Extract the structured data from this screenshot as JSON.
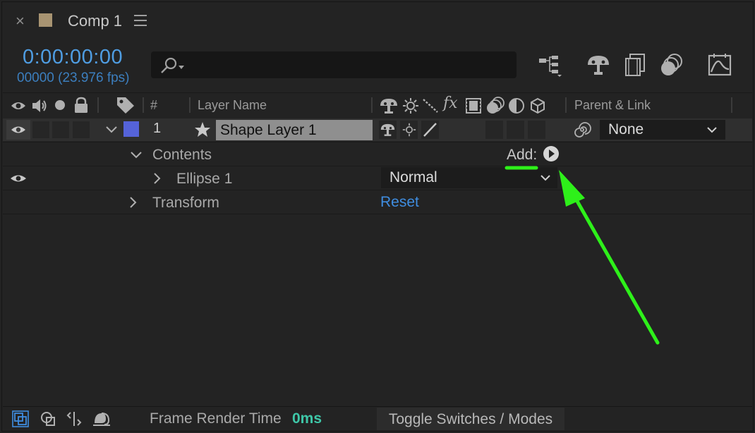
{
  "tab": {
    "close": "×",
    "title": "Comp 1"
  },
  "timecode": {
    "time": "0:00:00:00",
    "frames": "00000 (23.976 fps)"
  },
  "search": {
    "placeholder": "",
    "value": ""
  },
  "columns": {
    "number": "#",
    "layer_name": "Layer Name",
    "parent_link": "Parent & Link"
  },
  "layer": {
    "number": "1",
    "name": "Shape Layer 1",
    "parent": "None",
    "label_color": "#5563d9"
  },
  "contents": {
    "label": "Contents",
    "add_label": "Add:",
    "ellipse": {
      "label": "Ellipse 1",
      "blend_mode": "Normal"
    },
    "transform": {
      "label": "Transform",
      "reset": "Reset"
    }
  },
  "footer": {
    "frame_render_label": "Frame Render Time",
    "frame_render_value": "0ms",
    "toggle_label": "Toggle Switches / Modes"
  },
  "colors": {
    "accent_blue": "#4f9de2",
    "reset_blue": "#3f8de0",
    "render_green": "#3ec7a8",
    "annotation_green": "#2ef01a",
    "comp_swatch": "#a89472"
  },
  "icons": {
    "top_toolbar": [
      "flowchart-icon",
      "draft-3d-icon",
      "frame-blending-icon",
      "motion-blur-icon",
      "graph-editor-icon"
    ],
    "header_switches": [
      "shy-icon",
      "collapse-icon",
      "quality-icon",
      "effects-icon",
      "frame-blend-icon",
      "motion-blur-icon",
      "adjustment-icon",
      "3d-layer-icon"
    ],
    "bottom_toolbar": [
      "layer-switches-icon",
      "transfer-controls-icon",
      "in-out-icon",
      "render-time-icon"
    ]
  }
}
